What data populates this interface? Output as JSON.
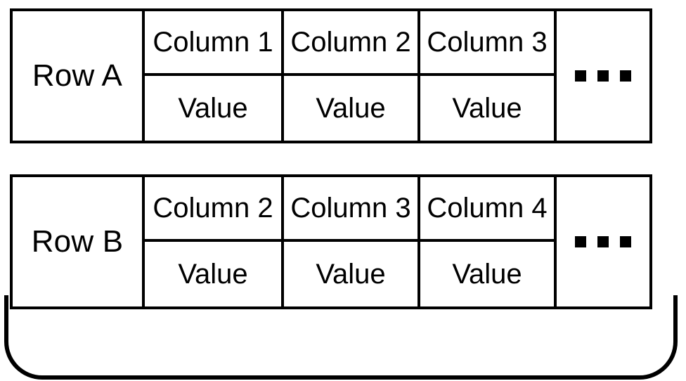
{
  "rows": [
    {
      "label": "Row A",
      "columns": [
        {
          "header": "Column 1",
          "value": "Value"
        },
        {
          "header": "Column 2",
          "value": "Value"
        },
        {
          "header": "Column 3",
          "value": "Value"
        }
      ],
      "ellipsis": true
    },
    {
      "label": "Row B",
      "columns": [
        {
          "header": "Column 2",
          "value": "Value"
        },
        {
          "header": "Column 3",
          "value": "Value"
        },
        {
          "header": "Column 4",
          "value": "Value"
        }
      ],
      "ellipsis": true
    }
  ]
}
